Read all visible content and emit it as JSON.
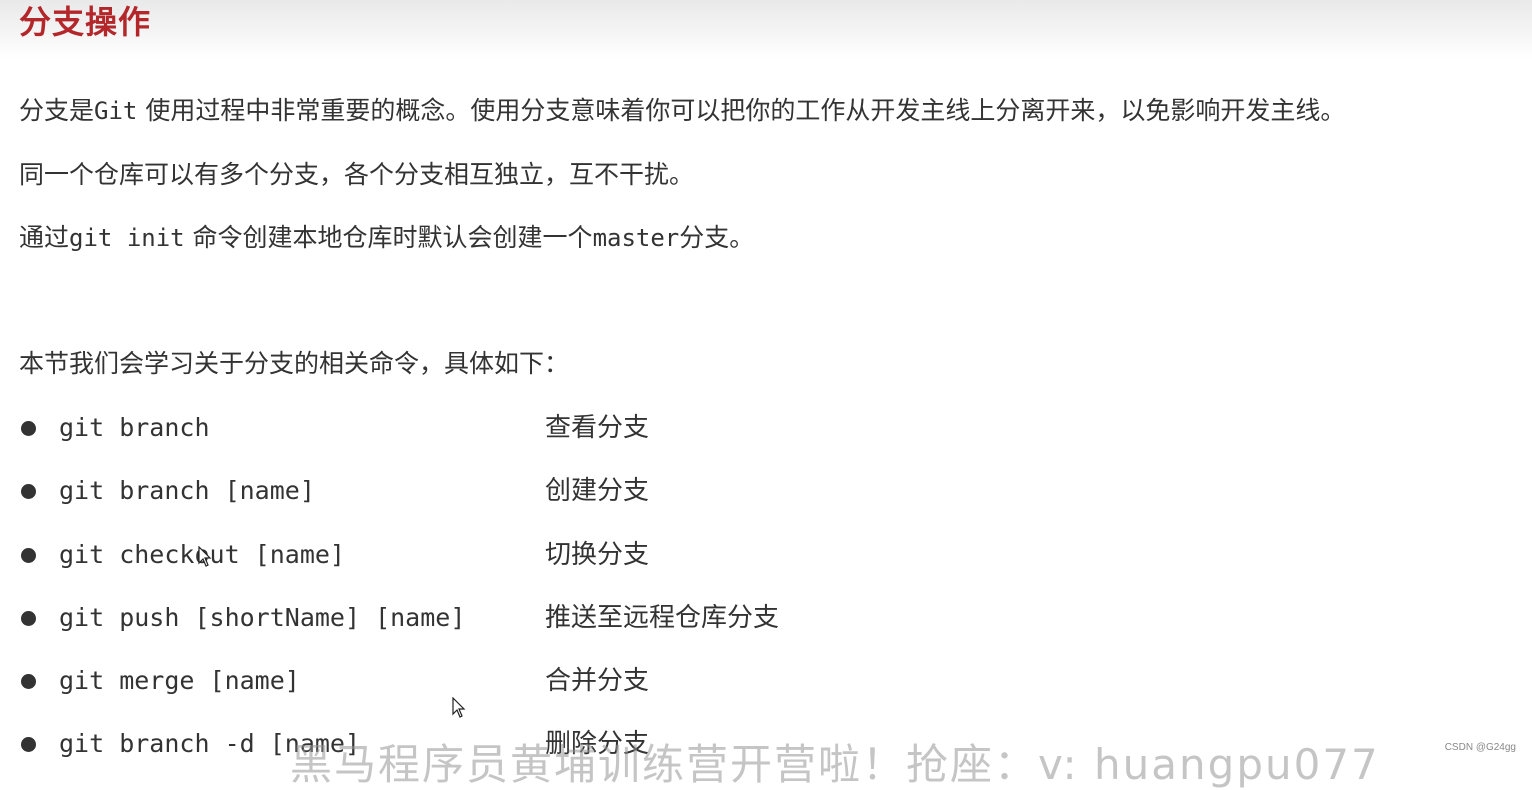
{
  "page": {
    "title": "分支操作"
  },
  "intro": {
    "line1_pre": "分支是",
    "line1_code": "Git",
    "line1_post": " 使用过程中非常重要的概念。使用分支意味着你可以把你的工作从开发主线上分离开来，以免影响开发主线。",
    "line2": "同一个仓库可以有多个分支，各个分支相互独立，互不干扰。",
    "line3_pre": "通过",
    "line3_code": "git init",
    "line3_mid": " 命令创建本地仓库时默认会创建一个",
    "line3_code2": "master",
    "line3_post": "分支。"
  },
  "commands_intro": "本节我们会学习关于分支的相关命令，具体如下：",
  "commands": [
    {
      "cmd": "git branch",
      "desc": "查看分支"
    },
    {
      "cmd": "git branch [name]",
      "desc": "创建分支"
    },
    {
      "cmd": "git checkout [name]",
      "desc": "切换分支"
    },
    {
      "cmd": "git push [shortName] [name]",
      "desc": "推送至远程仓库分支"
    },
    {
      "cmd": "git merge [name]",
      "desc": "合并分支"
    },
    {
      "cmd": "git branch -d [name]",
      "desc": "删除分支"
    }
  ],
  "watermark": "黑马程序员黄埔训练营开营啦！抢座：v: huangpu077",
  "credit": "CSDN @G24gg",
  "colors": {
    "title": "#b3262a",
    "text": "#333333"
  }
}
